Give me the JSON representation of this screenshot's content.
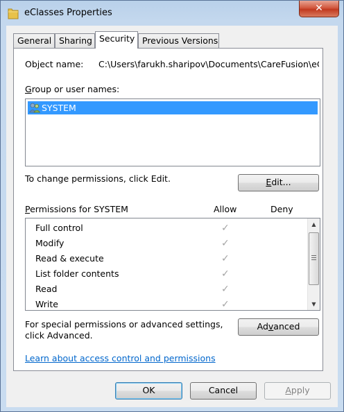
{
  "window": {
    "title": "eClasses Properties",
    "close_glyph": "✕",
    "icon": "folder-icon"
  },
  "tabs": [
    {
      "label": "General"
    },
    {
      "label": "Sharing"
    },
    {
      "label": "Security"
    },
    {
      "label": "Previous Versions"
    }
  ],
  "active_tab": "Security",
  "object": {
    "label": "Object name:",
    "value": "C:\\Users\\farukh.sharipov\\Documents\\CareFusion\\eCla"
  },
  "group_section": {
    "label_prefix": "G",
    "label_rest": "roup or user names:",
    "users": [
      {
        "name": "SYSTEM",
        "icon": "users-icon",
        "selected": true
      }
    ]
  },
  "edit": {
    "hint": "To change permissions, click Edit.",
    "button_label_u": "E",
    "button_label_rest": "dit..."
  },
  "permissions": {
    "label_prefix": "P",
    "label_rest": "ermissions for SYSTEM",
    "allow_header": "Allow",
    "deny_header": "Deny",
    "check_glyph": "✓",
    "rows": [
      {
        "name": "Full control",
        "allow": true,
        "deny": false
      },
      {
        "name": "Modify",
        "allow": true,
        "deny": false
      },
      {
        "name": "Read & execute",
        "allow": true,
        "deny": false
      },
      {
        "name": "List folder contents",
        "allow": true,
        "deny": false
      },
      {
        "name": "Read",
        "allow": true,
        "deny": false
      },
      {
        "name": "Write",
        "allow": true,
        "deny": false
      }
    ]
  },
  "advanced": {
    "hint_line1": "For special permissions or advanced settings,",
    "hint_line2": "click Advanced.",
    "button_label_pre": "Ad",
    "button_label_u": "v",
    "button_label_rest": "anced"
  },
  "help_link": "Learn about access control and permissions",
  "footer": {
    "ok": "OK",
    "cancel": "Cancel",
    "apply_u": "A",
    "apply_rest": "pply"
  }
}
